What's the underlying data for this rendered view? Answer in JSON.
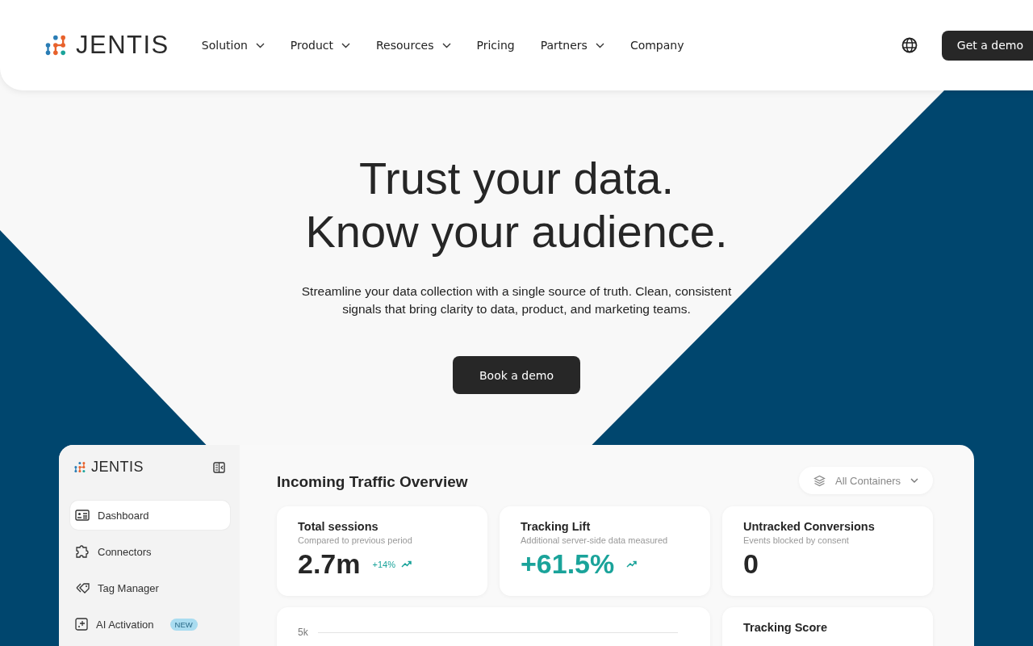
{
  "header": {
    "logo": "JENTIS",
    "nav": [
      {
        "label": "Solution",
        "dropdown": true
      },
      {
        "label": "Product",
        "dropdown": true
      },
      {
        "label": "Resources",
        "dropdown": true
      },
      {
        "label": "Pricing",
        "dropdown": false
      },
      {
        "label": "Partners",
        "dropdown": true
      },
      {
        "label": "Company",
        "dropdown": false
      }
    ],
    "cta": "Get a demo"
  },
  "hero": {
    "title_lines": [
      "Trust your data.",
      "Know your audience."
    ],
    "subtitle": "Streamline your data collection with a single source of truth. Clean, consistent signals that bring clarity to data, product, and marketing teams.",
    "button": "Book a demo"
  },
  "dashboard": {
    "logo": "JENTIS",
    "sidebar": [
      {
        "label": "Dashboard",
        "selected": true
      },
      {
        "label": "Connectors",
        "selected": false
      },
      {
        "label": "Tag Manager",
        "selected": false
      },
      {
        "label": "AI Activation",
        "selected": false,
        "badge": "NEW"
      }
    ],
    "title": "Incoming Traffic Overview",
    "filter": "All Containers",
    "cards": [
      {
        "title": "Total sessions",
        "subtitle": "Compared to previous period",
        "value": "2.7m",
        "accent": false,
        "change": "+14%",
        "trend": true
      },
      {
        "title": "Tracking Lift",
        "subtitle": "Additional server-side data measured",
        "value": "+61.5%",
        "accent": true,
        "trend": true
      },
      {
        "title": "Untracked Conversions",
        "subtitle": "Events blocked by consent",
        "value": "0",
        "accent": false,
        "trend": false
      }
    ],
    "chart_tick": "5k",
    "score_title": "Tracking Score"
  }
}
